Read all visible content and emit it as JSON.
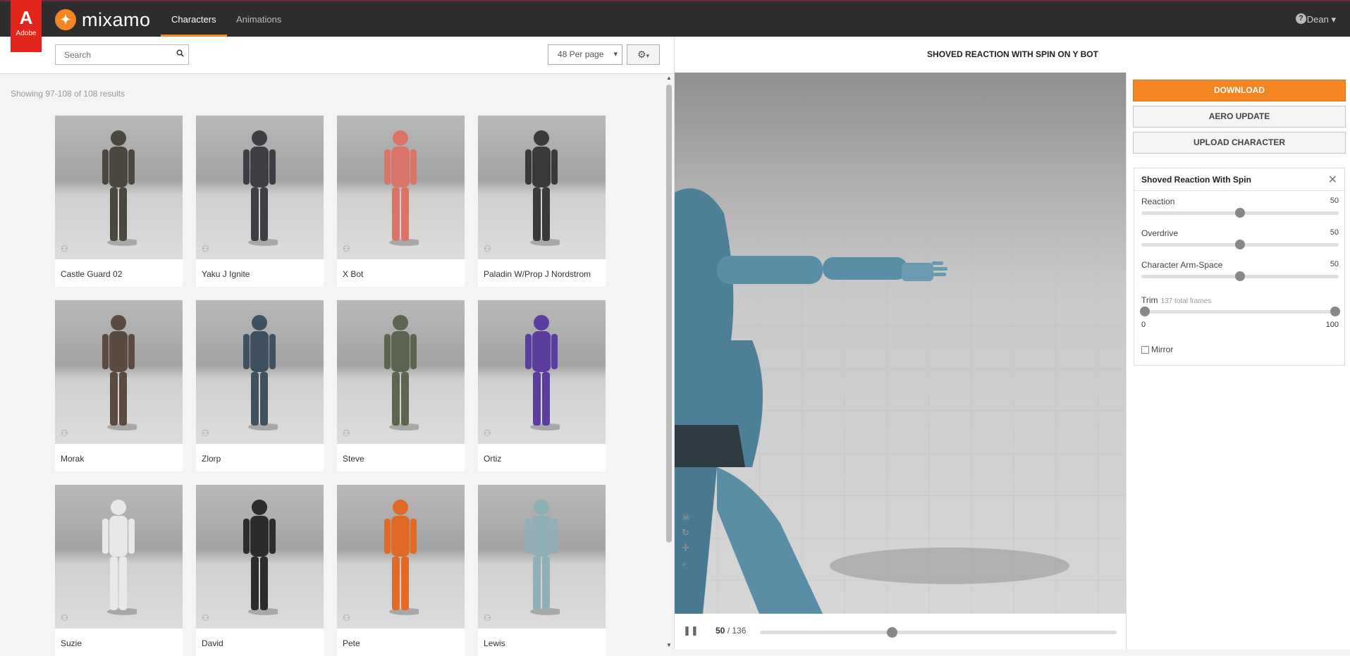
{
  "header": {
    "adobe_label": "Adobe",
    "brand": "mixamo",
    "tabs": [
      {
        "label": "Characters"
      },
      {
        "label": "Animations"
      }
    ],
    "help_symbol": "?",
    "user": "Dean"
  },
  "toolbar": {
    "search_placeholder": "Search",
    "per_page": "48 Per page"
  },
  "results_text": "Showing 97-108 of 108 results",
  "characters": [
    {
      "name": "Castle Guard 02",
      "color": "#4a4640"
    },
    {
      "name": "Yaku J Ignite",
      "color": "#3d3f45"
    },
    {
      "name": "X Bot",
      "color": "#d97468"
    },
    {
      "name": "Paladin W/Prop J Nordstrom",
      "color": "#3a3a3c"
    },
    {
      "name": "Morak",
      "color": "#5a4a40"
    },
    {
      "name": "Zlorp",
      "color": "#3f5060"
    },
    {
      "name": "Steve",
      "color": "#5d6450"
    },
    {
      "name": "Ortiz",
      "color": "#5a3d9e"
    },
    {
      "name": "Suzie",
      "color": "#e8e8e8"
    },
    {
      "name": "David",
      "color": "#2c2c2c"
    },
    {
      "name": "Pete",
      "color": "#e06b28"
    },
    {
      "name": "Lewis",
      "color": "#8fb0b6"
    }
  ],
  "viewer": {
    "title": "SHOVED REACTION WITH SPIN ON Y BOT",
    "frame_current": "50",
    "frame_total": "/ 136",
    "playhead_fraction": 0.37
  },
  "side": {
    "download": "DOWNLOAD",
    "aero_update": "AERO UPDATE",
    "upload": "UPLOAD CHARACTER",
    "panel_title": "Shoved Reaction With Spin",
    "params": [
      {
        "label": "Reaction",
        "value": "50",
        "fraction": 0.5
      },
      {
        "label": "Overdrive",
        "value": "50",
        "fraction": 0.5
      },
      {
        "label": "Character Arm-Space",
        "value": "50",
        "fraction": 0.5
      }
    ],
    "trim": {
      "label": "Trim",
      "sub": "137 total frames",
      "min": "0",
      "max": "100"
    },
    "mirror": "Mirror"
  }
}
